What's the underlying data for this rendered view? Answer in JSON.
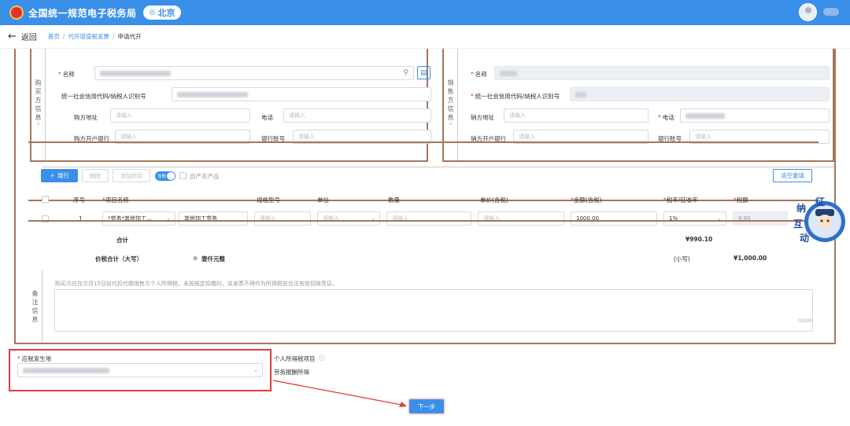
{
  "header": {
    "app_title": "全国统一规范电子税务局",
    "region": "北京",
    "brand_color": "#3a8fe8"
  },
  "nav": {
    "back_label": "返回",
    "breadcrumbs": [
      "首页",
      "代开增值税发票",
      "申请代开"
    ]
  },
  "buyer": {
    "section_label": [
      "购",
      "买",
      "方",
      "信",
      "息"
    ],
    "name_label": "名称",
    "tax_id_label": "统一社会信用代码/纳税人识别号",
    "address_label": "购方地址",
    "address_placeholder": "请输入",
    "phone_label": "电话",
    "phone_placeholder": "请输入",
    "bank_label": "购方开户银行",
    "bank_placeholder": "请输入",
    "account_label": "银行账号",
    "account_placeholder": "请输入"
  },
  "seller": {
    "section_label": [
      "销",
      "售",
      "方",
      "信",
      "息"
    ],
    "name_label": "名称",
    "tax_id_label": "统一社会信用代码/纳税人识别号",
    "address_label": "销方地址",
    "address_placeholder": "请输入",
    "phone_label": "电话",
    "bank_label": "销方开户银行",
    "bank_placeholder": "请输入",
    "account_label": "银行账号",
    "account_placeholder": "请输入"
  },
  "toolbar": {
    "add_row": "＋ 增行",
    "delete": "删除",
    "add_discount": "添加折扣",
    "tax_included_switch": "含税",
    "self_produced_agri": "自产农产品",
    "clear_all": "清空重填"
  },
  "items": {
    "headers": {
      "index": "序号",
      "item_name": "项目名称",
      "spec": "规格型号",
      "unit": "单位",
      "quantity": "数量",
      "unit_price": "单价(含税)",
      "amount": "金额(含税)",
      "rate": "税率/征收率",
      "tax": "税额"
    },
    "rows": [
      {
        "index": "1",
        "category": "*劳务*其他加工...",
        "item_name": "其他加工劳务",
        "spec_placeholder": "请输入",
        "unit_placeholder": "请输入",
        "quantity_placeholder": "请输入",
        "price_placeholder": "请输入",
        "amount": "1000.00",
        "rate": "1%",
        "tax": "9.90"
      }
    ],
    "total_label": "合计",
    "total_amount": "¥990.10"
  },
  "price_total": {
    "label": "价税合计（大写）",
    "uppercase": "壹仟元整",
    "small_label": "(小写)",
    "small_value": "¥1,000.00"
  },
  "remarks": {
    "section_label": [
      "备",
      "注",
      "信",
      "息"
    ],
    "hint": "购买方应在次月15日前代扣代缴销售方个人所得税，未按规定扣缴的，该发票不得作为所得税前合法有效扣除凭证。",
    "counter": "0/200"
  },
  "tax_place": {
    "label": "应税发生地"
  },
  "income_tax": {
    "label": "个人所得税项目",
    "value": "劳务报酬所得"
  },
  "next_button": "下一步",
  "mascot": {
    "chars": [
      "征",
      "纳",
      "互",
      "动"
    ]
  }
}
